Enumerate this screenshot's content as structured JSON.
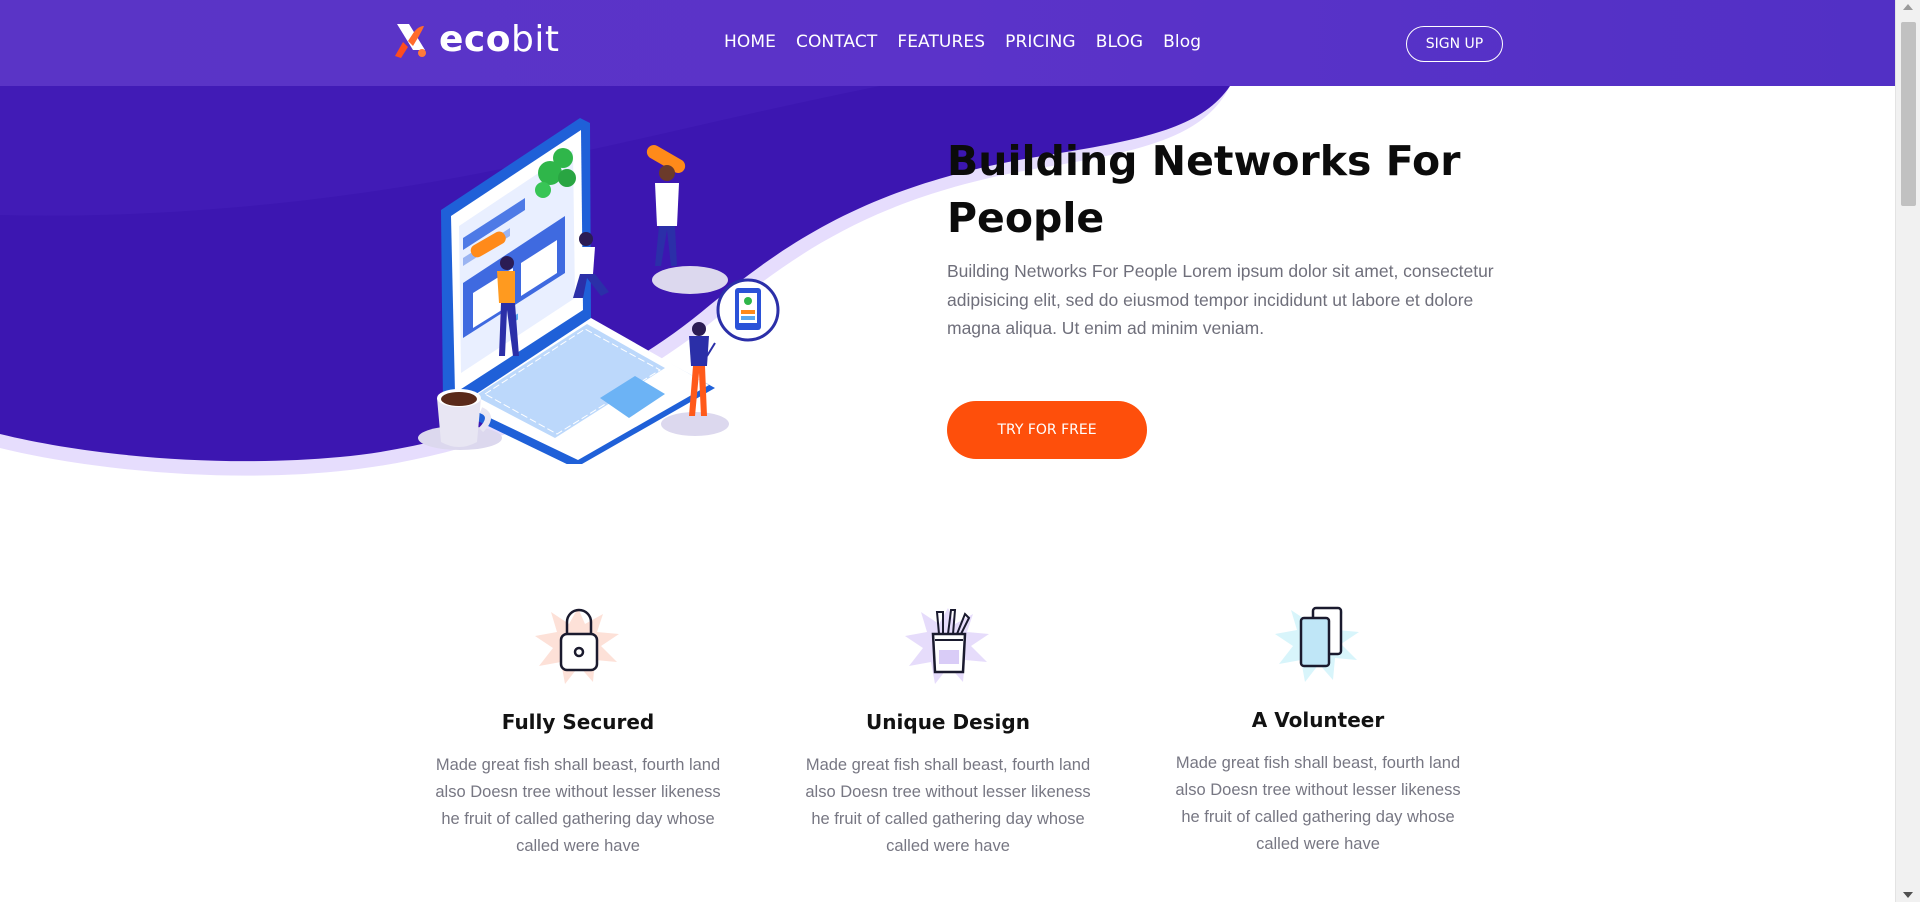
{
  "brand": {
    "name_bold": "eco",
    "name_light": "bit",
    "icon": "ecobit-x-logo-icon"
  },
  "nav": {
    "items": [
      "HOME",
      "CONTACT",
      "FEATURES",
      "PRICING",
      "BLOG",
      "Blog"
    ],
    "signup_label": "SIGN UP"
  },
  "hero": {
    "title": "Building Networks For People",
    "text": "Building Networks For People Lorem ipsum dolor sit amet, consectetur adipisicing elit, sed do eiusmod tempor incididunt ut labore et dolore magna aliqua. Ut enim ad minim veniam.",
    "cta_label": "TRY FOR FREE",
    "illustration": "isometric-laptop-team-illustration"
  },
  "features": [
    {
      "icon": "padlock-icon",
      "title": "Fully Secured",
      "text": "Made great fish shall beast, fourth land also Doesn tree without lesser likeness he fruit of called gathering day whose called were have"
    },
    {
      "icon": "pencil-cup-icon",
      "title": "Unique Design",
      "text": "Made great fish shall beast, fourth land also Doesn tree without lesser likeness he fruit of called gathering day whose called were have"
    },
    {
      "icon": "copy-documents-icon",
      "title": "A Volunteer",
      "text": "Made great fish shall beast, fourth land also Doesn tree without lesser likeness he fruit of called gathering day whose called were have"
    }
  ],
  "colors": {
    "header_purple": "#5a34c6",
    "hero_purple": "#3c16b0",
    "hero_lavender": "#e4dcfd",
    "cta_orange": "#fe4f0b",
    "splash_peach": "#fde1d8",
    "splash_lilac": "#e6dcfb",
    "splash_cyan": "#d8f5fb"
  }
}
